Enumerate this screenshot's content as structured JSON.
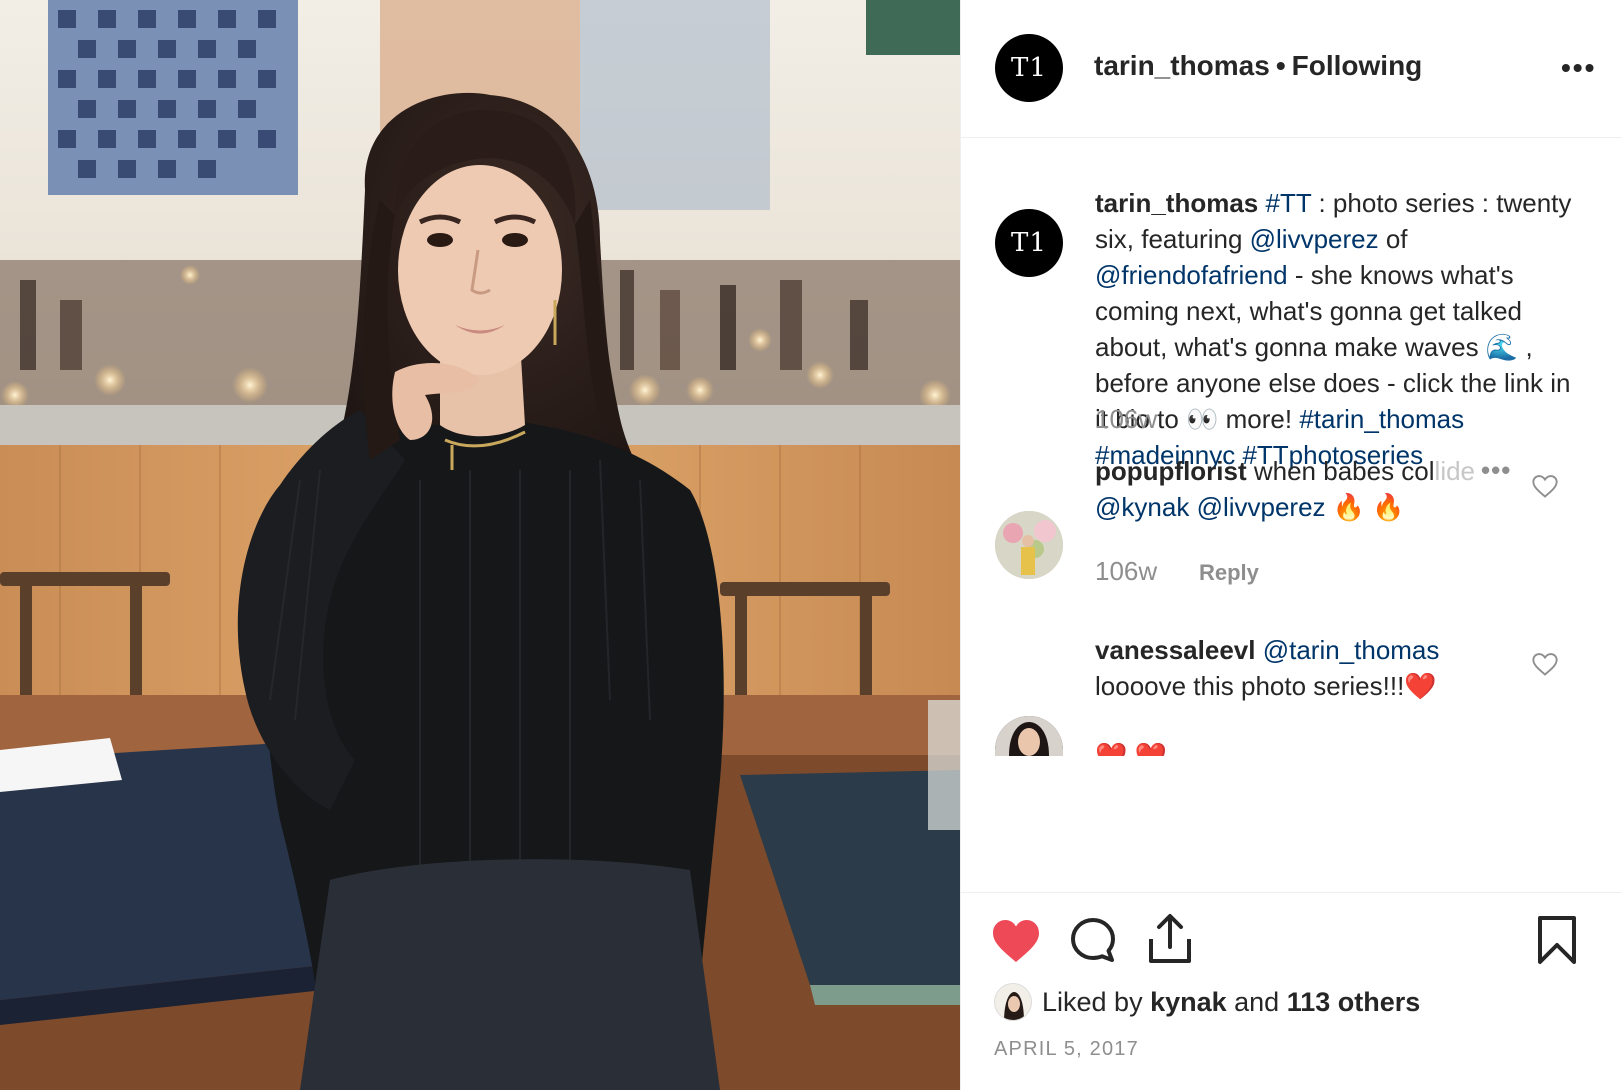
{
  "header": {
    "avatar_initials": "T1",
    "username": "tarin_thomas",
    "separator": "•",
    "follow_status": "Following",
    "more_icon": "more-horizontal-icon",
    "more_label": "•••"
  },
  "caption": {
    "avatar_initials": "T1",
    "username": "tarin_thomas",
    "tag_tt": "#TT",
    "text_1": " : photo series : twenty six, featuring ",
    "mention_1": "@livvperez",
    "text_2": " of ",
    "mention_2": "@friendofafriend",
    "text_3": " - she knows what's coming next, what's gonna get talked about, what's gonna make waves 🌊 , before anyone else does - click the link in it bio to 👀  more! ",
    "hashtag_1": "#tarin_thomas",
    "hashtag_2": "#madeinnyc",
    "hashtag_3": "#TTphotoseries",
    "time": "106w"
  },
  "comments": [
    {
      "username": "popupflorist",
      "text_visible": " when babes col",
      "text_faded": "lide",
      "mention_1": "@kynak",
      "mention_2": "@livvperez",
      "emoji": " 🔥 🔥",
      "more_label": "•••",
      "time": "106w",
      "reply_label": "Reply"
    },
    {
      "username": "vanessaleevl",
      "mention": "@tarin_thomas",
      "text": "loooove this photo series!!!❤️",
      "overflow_text": "❤️ ❤️"
    }
  ],
  "actions": {
    "like_icon": "heart-filled-icon",
    "comment_icon": "comment-bubble-icon",
    "share_icon": "share-icon",
    "save_icon": "bookmark-icon",
    "liked_state": true
  },
  "likes": {
    "prefix": "Liked by ",
    "user": "kynak",
    "middle": " and ",
    "others": "113 others"
  },
  "post_date": "APRIL 5, 2017",
  "colors": {
    "text": "#262626",
    "link": "#003569",
    "muted": "#8e8e8e",
    "like_red": "#ed4956",
    "border": "#efefef"
  }
}
